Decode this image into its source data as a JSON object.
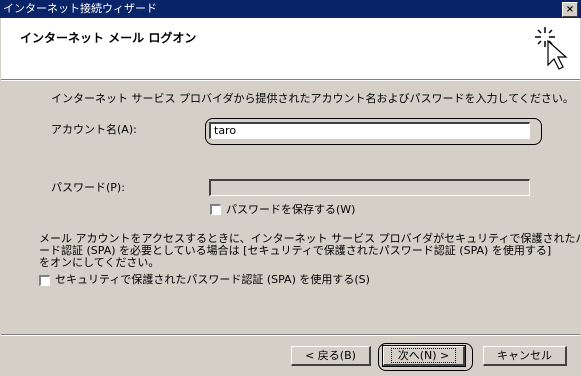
{
  "window": {
    "title": "インターネット接続ウィザード",
    "close_label": "×"
  },
  "header": {
    "heading": "インターネット メール ログオン",
    "icon": "wizard-sparkle-icon"
  },
  "intro": "インターネット サービス プロバイダから提供されたアカウント名およびパスワードを入力してください。",
  "account": {
    "label": "アカウント名(A):",
    "value": "taro"
  },
  "password": {
    "label": "パスワード(P):",
    "value": "",
    "save_label": "パスワードを保存する(W)",
    "save_checked": false
  },
  "spa": {
    "line1": "メール アカウントをアクセスするときに、インターネット サービス プロバイダがセキュリティで保護されたパスワ",
    "line2": "ード認証 (SPA) を必要としている場合は [セキュリティで保護されたパスワード認証 (SPA) を使用する]",
    "line3": "をオンにしてください。",
    "checkbox_label": "セキュリティで保護されたパスワード認証 (SPA) を使用する(S)",
    "checked": false
  },
  "buttons": {
    "back": "< 戻る(B)",
    "next": "次へ(N) >",
    "cancel": "キャンセル"
  }
}
